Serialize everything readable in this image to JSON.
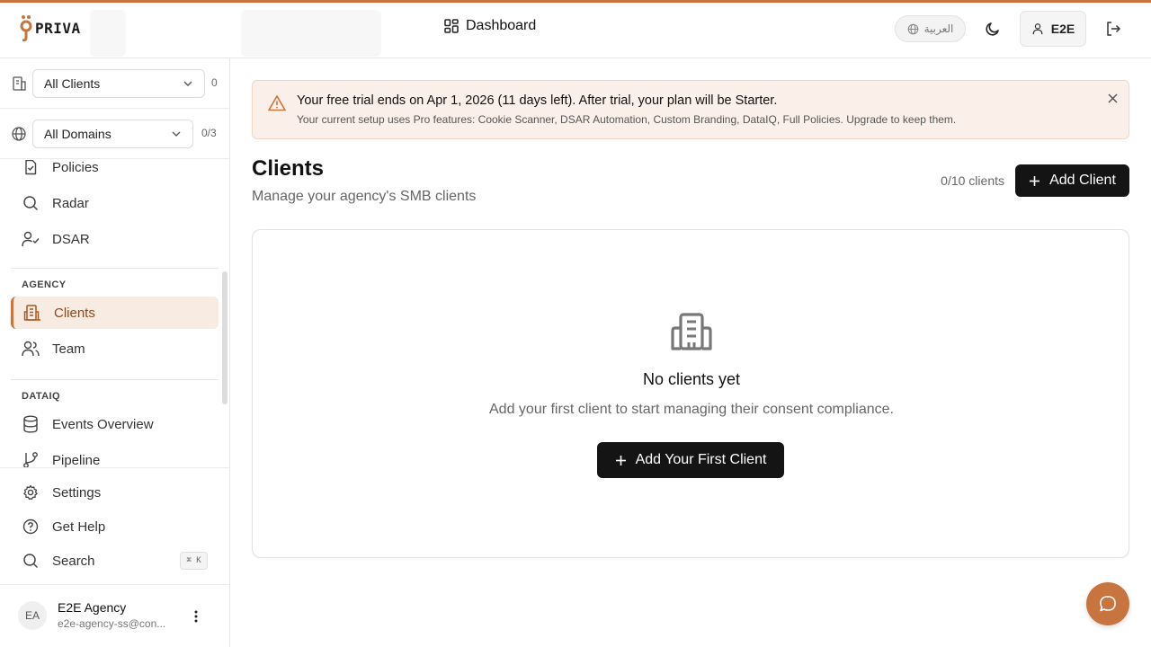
{
  "brand": {
    "logo_text": "PRIVA",
    "accent_color": "#c8743e"
  },
  "header": {
    "title": "Dashboard",
    "language_label": "العربية",
    "user_label": "E2E"
  },
  "filters": {
    "clients": {
      "selected": "All Clients",
      "count": "0"
    },
    "domains": {
      "selected": "All Domains",
      "count": "0/3"
    }
  },
  "sidebar": {
    "top_items": [
      {
        "label": "Policies"
      },
      {
        "label": "Radar"
      },
      {
        "label": "DSAR"
      }
    ],
    "sections": [
      {
        "label": "AGENCY",
        "items": [
          {
            "label": "Clients",
            "active": true
          },
          {
            "label": "Team"
          }
        ]
      },
      {
        "label": "DATAIQ",
        "items": [
          {
            "label": "Events Overview"
          },
          {
            "label": "Pipeline"
          }
        ]
      }
    ],
    "bottom_items": [
      {
        "label": "Settings"
      },
      {
        "label": "Get Help"
      },
      {
        "label": "Search",
        "shortcut": "⌘ K"
      }
    ],
    "user": {
      "initials": "EA",
      "name": "E2E Agency",
      "email": "e2e-agency-ss@con..."
    }
  },
  "banner": {
    "title": "Your free trial ends on Apr 1, 2026 (11 days left). After trial, your plan will be Starter.",
    "text": "Your current setup uses Pro features: Cookie Scanner, DSAR Automation, Custom Branding, DataIQ, Full Policies. Upgrade to keep them."
  },
  "main": {
    "title": "Clients",
    "subtitle": "Manage your agency's SMB clients",
    "client_count": "0/10 clients",
    "add_button": "Add Client",
    "empty": {
      "title": "No clients yet",
      "text": "Add your first client to start managing their consent compliance.",
      "button": "Add Your First Client"
    }
  }
}
